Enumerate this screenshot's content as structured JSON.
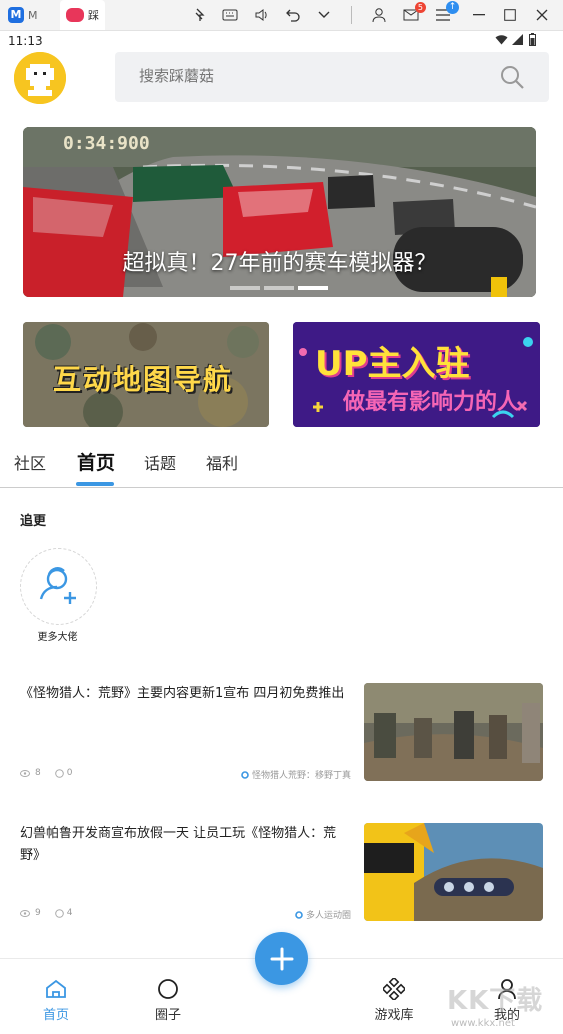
{
  "titlebar": {
    "tab1_label": "M",
    "tab2_label": "踩",
    "mail_badge": "5"
  },
  "statusbar": {
    "time": "11:13"
  },
  "search": {
    "placeholder": "搜索踩蘑菇"
  },
  "banner": {
    "caption": "超拟真！27年前的赛车模拟器？",
    "hud_text": "0:34:900",
    "slides": 3,
    "active_slide": 2
  },
  "cards": [
    {
      "text": "互动地图导航"
    },
    {
      "line1": "UP主入驻",
      "line2": "做最有影响力的人"
    }
  ],
  "tabs": [
    {
      "label": "社区"
    },
    {
      "label": "首页"
    },
    {
      "label": "话题"
    },
    {
      "label": "福利"
    }
  ],
  "active_tab": "首页",
  "follow": {
    "title": "追更",
    "more_label": "更多大佬"
  },
  "articles": [
    {
      "title": "《怪物猎人：荒野》主要内容更新1宣布 四月初免费推出",
      "views": "8",
      "comments": "0",
      "tag": "怪物猎人荒野：移野丁真"
    },
    {
      "title": "幻兽帕鲁开发商宣布放假一天 让员工玩《怪物猎人：荒野》",
      "views": "9",
      "comments": "4",
      "tag": "多人运动圈"
    }
  ],
  "bottom_nav": [
    {
      "label": "首页",
      "icon": "home-icon"
    },
    {
      "label": "圈子",
      "icon": "circle-icon"
    },
    {
      "label": "游戏库",
      "icon": "gamepad-icon"
    },
    {
      "label": "我的",
      "icon": "user-icon"
    }
  ],
  "watermark": {
    "text": "KK下载",
    "url": "www.kkx.net"
  },
  "colors": {
    "accent": "#3b97e3",
    "avatar": "#f7c520"
  }
}
